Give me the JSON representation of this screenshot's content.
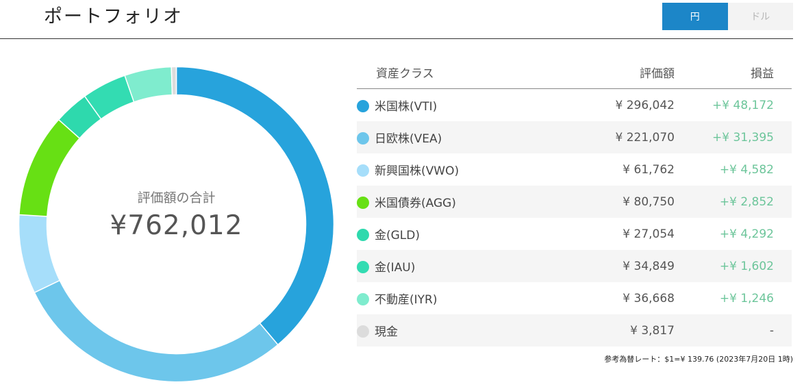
{
  "header": {
    "title": "ポートフォリオ"
  },
  "currency_toggle": {
    "options": [
      "円",
      "ドル"
    ],
    "selected": "円"
  },
  "summary": {
    "label": "評価額の合計",
    "total": "¥762,012"
  },
  "table": {
    "columns": [
      "資産クラス",
      "評価額",
      "損益"
    ],
    "rows": [
      {
        "name": "米国株(VTI)",
        "value": "¥ 296,042",
        "pl": "+¥ 48,172",
        "color": "#27a3dc",
        "amount": 296042
      },
      {
        "name": "日欧株(VEA)",
        "value": "¥ 221,070",
        "pl": "+¥ 31,395",
        "color": "#6dc6eb",
        "amount": 221070
      },
      {
        "name": "新興国株(VWO)",
        "value": "¥ 61,762",
        "pl": "+¥ 4,582",
        "color": "#a6defa",
        "amount": 61762
      },
      {
        "name": "米国債券(AGG)",
        "value": "¥ 80,750",
        "pl": "+¥ 2,852",
        "color": "#67e014",
        "amount": 80750
      },
      {
        "name": "金(GLD)",
        "value": "¥ 27,054",
        "pl": "+¥ 4,292",
        "color": "#2ed9ad",
        "amount": 27054
      },
      {
        "name": "金(IAU)",
        "value": "¥ 34,849",
        "pl": "+¥ 1,602",
        "color": "#33dcb2",
        "amount": 34849
      },
      {
        "name": "不動産(IYR)",
        "value": "¥ 36,668",
        "pl": "+¥ 1,246",
        "color": "#7fecce",
        "amount": 36668
      },
      {
        "name": "現金",
        "value": "¥ 3,817",
        "pl": "-",
        "color": "#dcdcdc",
        "amount": 3817
      }
    ]
  },
  "footnote": "参考為替レート：$1=¥ 139.76 (2023年7月20日 1時)"
}
